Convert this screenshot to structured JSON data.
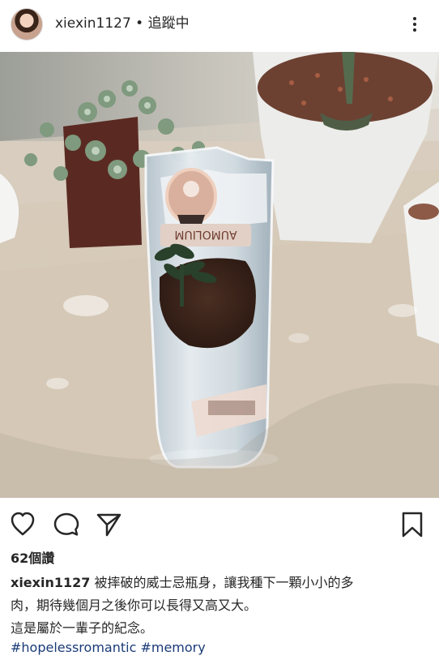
{
  "post": {
    "username": "xiexin1127",
    "separator": " • ",
    "follow_status": "追蹤中",
    "likes": "62個讚",
    "caption_line1": "被摔破的威士忌瓶身，讓我種下一顆小小的多",
    "caption_line2": "肉，期待幾個月之後你可以長得又高又大。",
    "caption_line3": "這是屬於一輩子的紀念。",
    "hashtags": [
      "#hopelessromantic",
      "#memory"
    ]
  },
  "icons": {
    "avatar": "profile-avatar",
    "more": "more-options-vertical-icon",
    "like": "heart-icon",
    "comment": "comment-bubble-icon",
    "share": "paper-plane-icon",
    "save": "bookmark-icon"
  },
  "colors": {
    "text": "#262626",
    "hashtag": "#1a3a77",
    "background": "#ffffff"
  }
}
